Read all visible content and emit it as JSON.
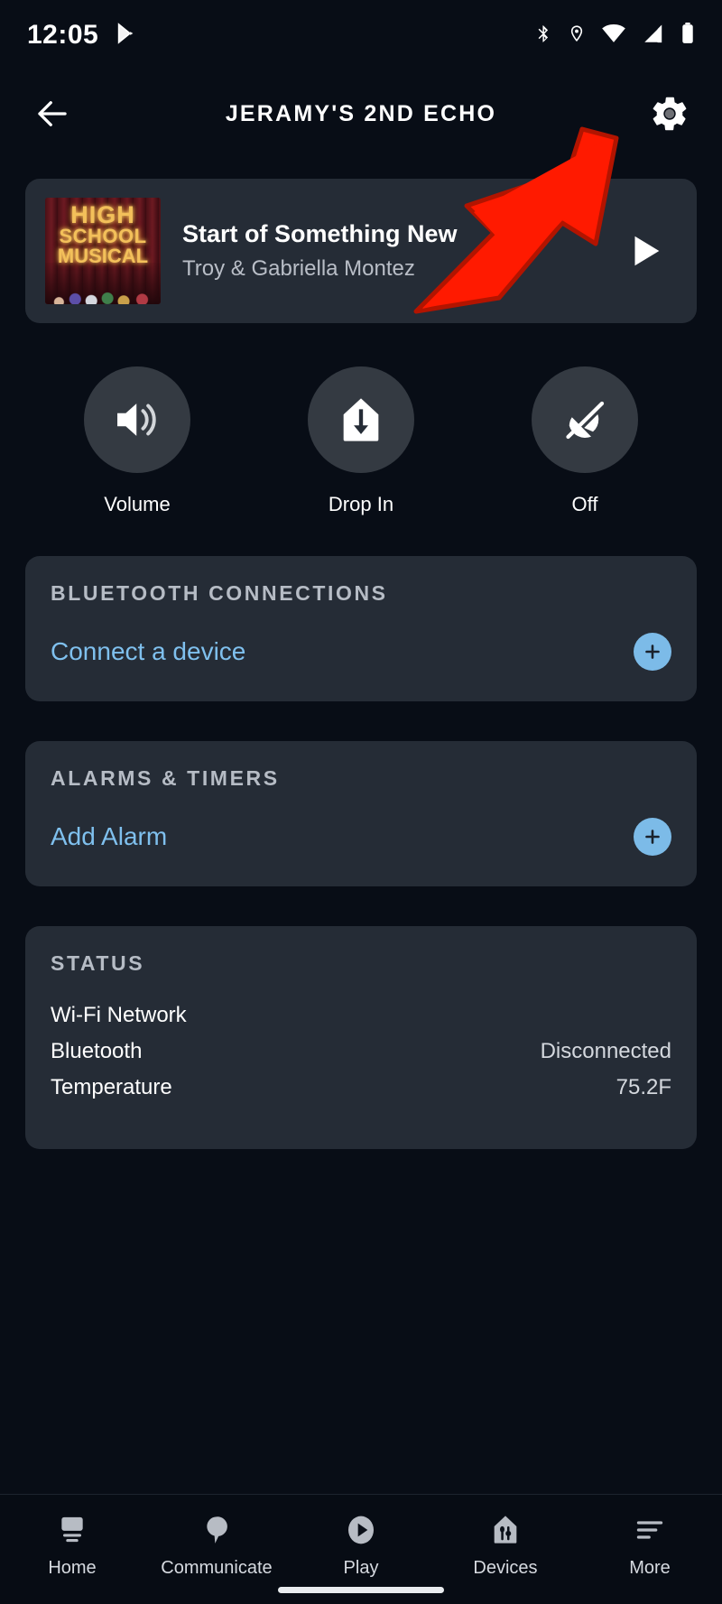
{
  "status_bar": {
    "time": "12:05",
    "left_icons": [
      "play-store-icon"
    ],
    "right_icons": [
      "bluetooth-icon",
      "location-icon",
      "wifi-icon",
      "cellular-signal-icon",
      "battery-icon"
    ]
  },
  "app_bar": {
    "back_label": "back-arrow",
    "title": "JERAMY'S 2ND ECHO",
    "settings_label": "gear-icon"
  },
  "now_playing": {
    "album_art": {
      "line1": "HIGH",
      "line2": "SCHOOL",
      "line3": "MUSICAL"
    },
    "title": "Start of Something New",
    "artist": "Troy & Gabriella Montez",
    "play_label": "play-icon"
  },
  "quick_actions": [
    {
      "icon": "volume-icon",
      "label": "Volume"
    },
    {
      "icon": "drop-in-icon",
      "label": "Drop In"
    },
    {
      "icon": "do-not-disturb-icon",
      "label": "Off"
    }
  ],
  "bluetooth_section": {
    "title": "BLUETOOTH CONNECTIONS",
    "link": "Connect a device",
    "add_label": "+"
  },
  "alarms_section": {
    "title": "ALARMS & TIMERS",
    "link": "Add Alarm",
    "add_label": "+"
  },
  "status_section": {
    "title": "STATUS",
    "rows": [
      {
        "key": "Wi-Fi Network",
        "value": ""
      },
      {
        "key": "Bluetooth",
        "value": "Disconnected"
      },
      {
        "key": "Temperature",
        "value": "75.2F"
      }
    ]
  },
  "bottom_nav": [
    {
      "icon": "home-icon",
      "label": "Home"
    },
    {
      "icon": "communicate-icon",
      "label": "Communicate"
    },
    {
      "icon": "play-circle-icon",
      "label": "Play"
    },
    {
      "icon": "devices-icon",
      "label": "Devices"
    },
    {
      "icon": "more-icon",
      "label": "More"
    }
  ],
  "annotation": {
    "type": "arrow",
    "color": "#FF1A00",
    "points_to": "settings-gear-button"
  },
  "colors": {
    "background": "#080d16",
    "card": "#252c36",
    "accent_link": "#7fc0ee",
    "accent_button": "#7cbbe8",
    "annotation_red": "#FF1A00"
  }
}
